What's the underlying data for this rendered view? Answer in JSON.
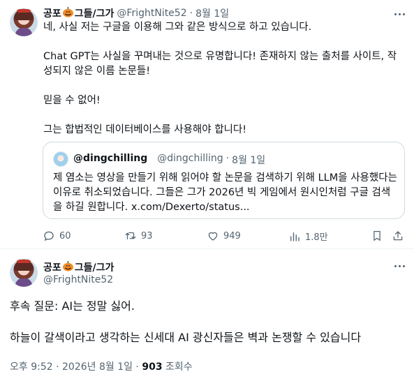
{
  "tweet1": {
    "author_name": "공포🎃그들/그가",
    "name_prefix": "공포",
    "name_suffix": "그들/그가",
    "handle": "@FrightNite52",
    "separator": "·",
    "date": "8월 1일",
    "paragraphs": [
      "네, 사실 저는 구글을 이용해 그와 같은 방식으로 하고 있습니다.",
      "Chat GPT는 사실을 꾸며내는 것으로 유명합니다! 존재하지 않는 출처를 사이트, 작\n성되지 않은 이름 논문들!",
      "믿을 수 없어!",
      "그는 합법적인 데이터베이스를 사용해야 합니다!"
    ],
    "quote": {
      "name": "@dingchilling",
      "handle": "@dingchilling",
      "separator": "·",
      "date": "8월 1일",
      "text": "제 염소는 영상을 만들기 위해 읽어야 할 논문을 검색하기 위해 LLM을 사용했다는 이유로 취소되었습니다. 그들은 그가 2026년 빅 게임에서 원시인처럼 구글 검색을 하길 원합니다. x.com/Dexerto/status..."
    },
    "actions": {
      "replies": "60",
      "retweets": "93",
      "likes": "949",
      "views": "1.8만"
    }
  },
  "tweet2": {
    "name_prefix": "공포",
    "name_suffix": "그들/그가",
    "handle": "@FrightNite52",
    "line1": "후속 질문: AI는 정말 싫어.",
    "line2": "하늘이 갈색이라고 생각하는 신세대 AI 광신자들은 벽과 논쟁할 수 있습니다",
    "meta_time": "오후 9:52 · 2026년 8월 1일 · ",
    "meta_views_count": "903",
    "meta_views_label": " 조회수"
  },
  "colors": {
    "text": "#0f1419",
    "secondary": "#536471",
    "border": "#cfd9de",
    "divider": "#eff3f4",
    "pumpkin": "#f28c28"
  },
  "icons": [
    "more-icon",
    "pumpkin-icon",
    "reply-icon",
    "retweet-icon",
    "like-icon",
    "views-icon",
    "bookmark-icon",
    "share-icon"
  ]
}
